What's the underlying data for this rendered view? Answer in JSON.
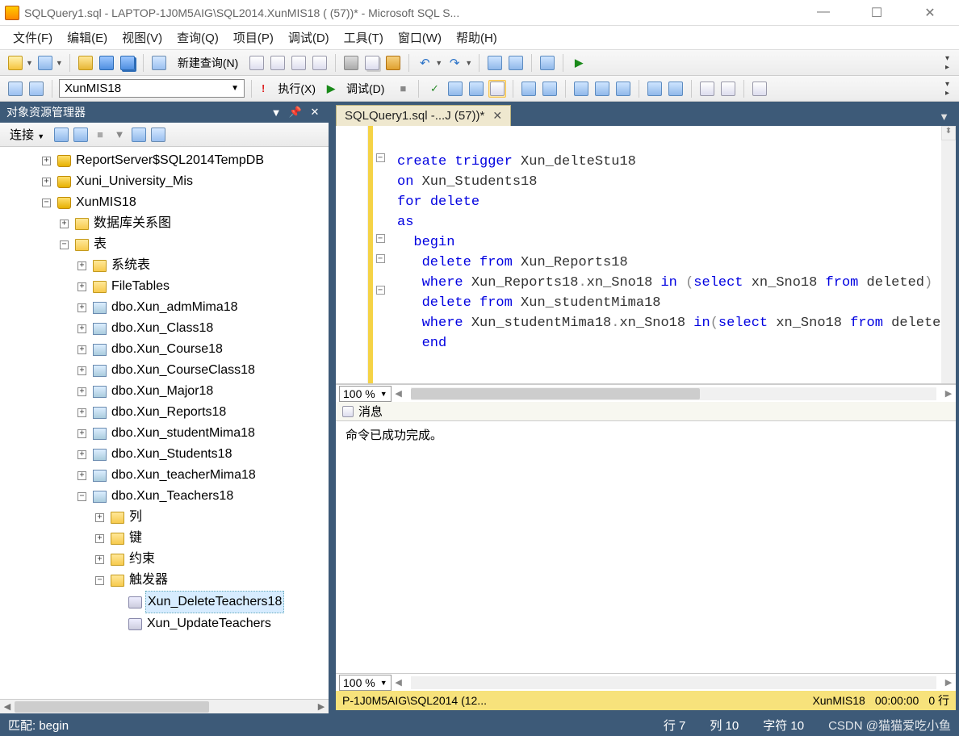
{
  "titlebar": "SQLQuery1.sql - LAPTOP-1J0M5AIG\\SQL2014.XunMIS18 (                                   (57))* - Microsoft SQL S...",
  "menus": [
    "文件(F)",
    "编辑(E)",
    "视图(V)",
    "查询(Q)",
    "项目(P)",
    "调试(D)",
    "工具(T)",
    "窗口(W)",
    "帮助(H)"
  ],
  "toolbar1": {
    "new_query": "新建查询(N)"
  },
  "toolbar2": {
    "db": "XunMIS18",
    "execute": "执行(X)",
    "debug": "调试(D)"
  },
  "objexp": {
    "title": "对象资源管理器",
    "connect": "连接",
    "nodes": {
      "db0": "ReportServer$SQL2014TempDB",
      "db1": "Xuni_University_Mis",
      "db2": "XunMIS18",
      "diagrams": "数据库关系图",
      "tables": "表",
      "systables": "系统表",
      "filetables": "FileTables",
      "t0": "dbo.Xun_admMima18",
      "t1": "dbo.Xun_Class18",
      "t2": "dbo.Xun_Course18",
      "t3": "dbo.Xun_CourseClass18",
      "t4": "dbo.Xun_Major18",
      "t5": "dbo.Xun_Reports18",
      "t6": "dbo.Xun_studentMima18",
      "t7": "dbo.Xun_Students18",
      "t8": "dbo.Xun_teacherMima18",
      "t9": "dbo.Xun_Teachers18",
      "cols": "列",
      "keys": "键",
      "constraints": "约束",
      "triggers": "触发器",
      "trig0": "Xun_DeleteTeachers18",
      "trig1": "Xun_UpdateTeachers"
    }
  },
  "tab": "SQLQuery1.sql -...J                    (57))*",
  "code": {
    "l1a": "create",
    "l1b": "trigger",
    "l1c": " Xun_delteStu18",
    "l2a": "on",
    "l2b": " Xun_Students18",
    "l3a": "for",
    "l3b": "delete",
    "l4": "as",
    "l5": "begin",
    "l6a": "delete",
    "l6b": "from",
    "l6c": " Xun_Reports18",
    "l7a": "where",
    "l7b": " Xun_Reports18",
    "l7d": "xn_Sno18 ",
    "l7e": "in",
    "l7g": "select",
    "l7h": " xn_Sno18 ",
    "l7i": "from",
    "l7j": " deleted",
    "l8a": "delete",
    "l8b": "from",
    "l8c": " Xun_studentMima18",
    "l9a": "where",
    "l9b": " Xun_studentMima18",
    "l9d": "xn_Sno18 ",
    "l9e": "in",
    "l9g": "select",
    "l9h": " xn_Sno18 ",
    "l9i": "from",
    "l9j": " delete",
    "l10": "end"
  },
  "zoom": "100 %",
  "messages_tab": "消息",
  "messages_body": "命令已成功完成。",
  "yellowbar": {
    "conn": "P-1J0M5AIG\\SQL2014 (12...",
    "db": "XunMIS18",
    "time": "00:00:00",
    "rows": "0 行"
  },
  "status": {
    "match": "匹配: begin",
    "line": "行 7",
    "col": "列 10",
    "char": "字符 10",
    "watermark": "CSDN @猫猫爱吃小鱼"
  }
}
